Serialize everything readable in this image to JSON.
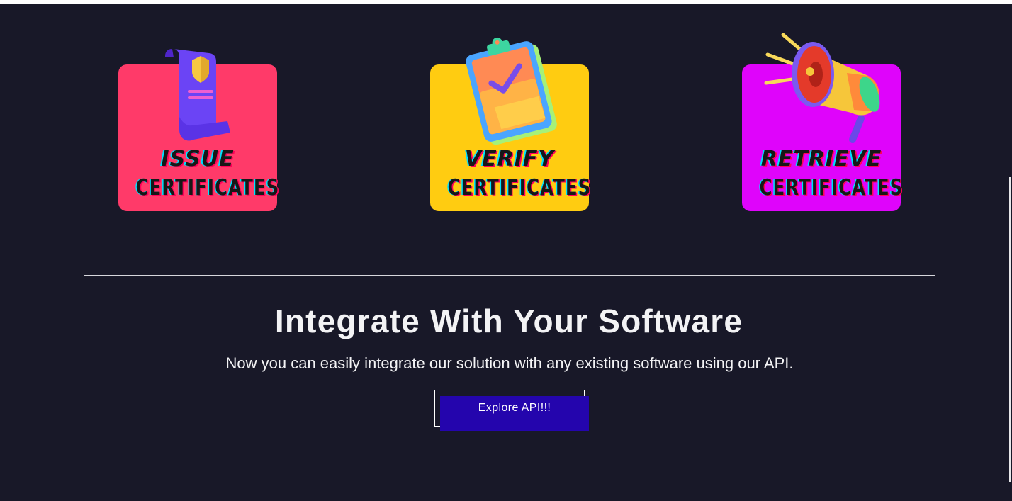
{
  "cards": [
    {
      "line1": "ISSUE",
      "line2": "CERTIFICATES",
      "color": "#ff3a69",
      "icon": "scroll-certificate-icon"
    },
    {
      "line1": "VERIFY",
      "line2": "CERTIFICATES",
      "color": "#ffcc11",
      "icon": "clipboard-check-icon"
    },
    {
      "line1": "RETRIEVE",
      "line2": "CERTIFICATES",
      "color": "#df04fb",
      "icon": "megaphone-icon"
    }
  ],
  "integrate": {
    "title": "Integrate With Your Software",
    "description": "Now you can easily integrate our solution with any existing software using our API.",
    "button_label": "Explore API!!!"
  },
  "colors": {
    "background": "#181828",
    "button": "#2405ad"
  }
}
